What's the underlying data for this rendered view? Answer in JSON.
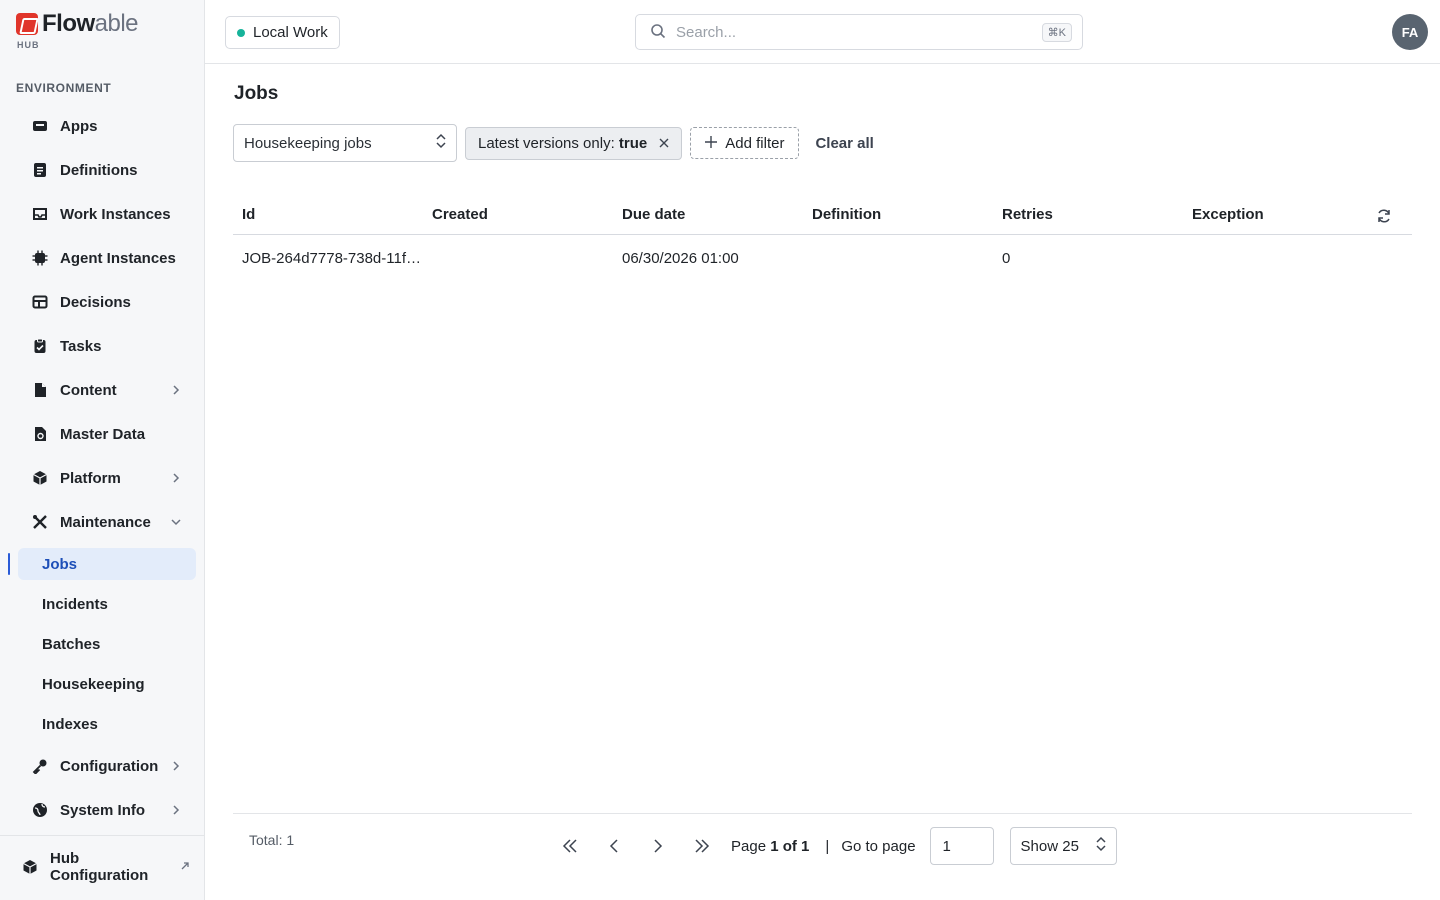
{
  "brand": {
    "name_bold": "Flow",
    "name_light": "able",
    "sub": "HUB",
    "logo_color": "#e0352b"
  },
  "sidebar": {
    "section_label": "ENVIRONMENT",
    "items": [
      {
        "label": "Apps",
        "icon": "apps-icon"
      },
      {
        "label": "Definitions",
        "icon": "definitions-icon"
      },
      {
        "label": "Work Instances",
        "icon": "inbox-icon"
      },
      {
        "label": "Agent Instances",
        "icon": "chip-icon"
      },
      {
        "label": "Decisions",
        "icon": "table-icon"
      },
      {
        "label": "Tasks",
        "icon": "clipboard-icon"
      },
      {
        "label": "Content",
        "icon": "file-icon",
        "expandable": true
      },
      {
        "label": "Master Data",
        "icon": "master-data-icon"
      },
      {
        "label": "Platform",
        "icon": "cube-icon",
        "expandable": true
      },
      {
        "label": "Maintenance",
        "icon": "tools-icon",
        "expanded": true
      }
    ],
    "maintenance_children": [
      {
        "label": "Jobs",
        "active": true
      },
      {
        "label": "Incidents"
      },
      {
        "label": "Batches"
      },
      {
        "label": "Housekeeping"
      },
      {
        "label": "Indexes"
      }
    ],
    "bottom_items": [
      {
        "label": "Configuration",
        "icon": "key-icon",
        "expandable": true
      },
      {
        "label": "System Info",
        "icon": "globe-icon",
        "expandable": true
      }
    ],
    "footer_label": "Hub Configuration",
    "accent": "#2a5bd7"
  },
  "topbar": {
    "environment": "Local Work",
    "environment_status_color": "#16b39a",
    "search_placeholder": "Search...",
    "search_shortcut": "⌘K",
    "avatar_initials": "FA"
  },
  "page": {
    "title": "Jobs",
    "job_type": "Housekeeping jobs",
    "filter_chip_label": "Latest versions only:",
    "filter_chip_value": "true",
    "add_filter": "Add filter",
    "clear_all": "Clear all"
  },
  "table": {
    "columns": [
      "Id",
      "Created",
      "Due date",
      "Definition",
      "Retries",
      "Exception"
    ],
    "rows": [
      [
        "JOB-264d7778-738d-11f…",
        "",
        "06/30/2026 01:00",
        "",
        "0",
        ""
      ]
    ]
  },
  "footer": {
    "total": "Total: 1",
    "page_prefix": "Page",
    "page_current": "1 of 1",
    "separator": "|",
    "go_to_page": "Go to page",
    "page_input": "1",
    "show": "Show 25"
  }
}
